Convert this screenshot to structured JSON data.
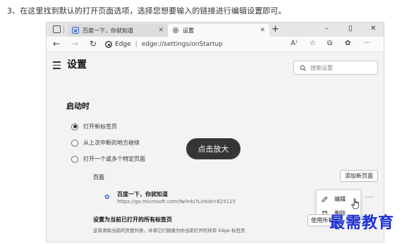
{
  "instruction": "3、在这里找到默认的打开页面选项，选择您想要输入的链接进行编辑设置即可。",
  "browser": {
    "tabs": [
      {
        "title": "百度一下，你就知道",
        "active": false,
        "icon": "baidu-paw-icon"
      },
      {
        "title": "设置",
        "active": true,
        "icon": "gear-icon"
      }
    ],
    "window_controls": {
      "minimize": "–",
      "maximize": "▯",
      "close": "✕"
    },
    "address": {
      "brand": "Edge",
      "url": "edge://settings/onStartup"
    }
  },
  "settings": {
    "title": "设置",
    "search_placeholder": "搜索设置",
    "section_title": "启动时",
    "radio_options": [
      {
        "label": "打开新标签页",
        "selected": true
      },
      {
        "label": "从上次中断的地方继续",
        "selected": false
      },
      {
        "label": "打开一个或多个特定页面",
        "selected": false
      }
    ],
    "pages_label": "页面",
    "add_page_button": "添加新页面",
    "page_entry": {
      "title": "百度一下，你就知道",
      "url": "https://go.microsoft.com/fwlink/?LinkId=625115"
    },
    "context_menu": {
      "edit": "编辑",
      "delete": "删除"
    },
    "more_label": "···",
    "set_current": {
      "title": "设置为当前已打开的所有标签页",
      "description": "这将清除当前的页面列表，并将它们替换为你当前打开的所有 Edge 标签页",
      "button": "使用所有已打开的标签页"
    }
  },
  "overlay": {
    "zoom_label": "点击放大"
  },
  "watermark": "最需教育",
  "colors": {
    "accent": "#1b2fd4",
    "overlay_bg": "#1a1a1a"
  }
}
